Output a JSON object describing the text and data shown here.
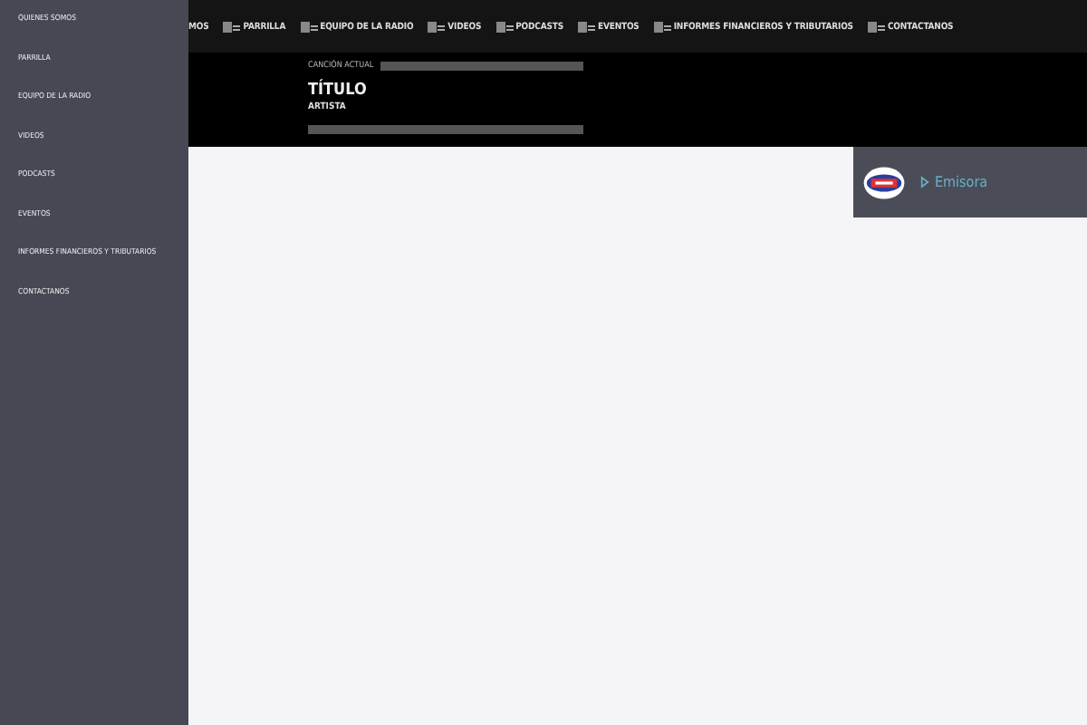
{
  "nav": [
    {
      "label": "MOS",
      "icon": false
    },
    {
      "label": "PARRILLA",
      "icon": true
    },
    {
      "label": "EQUIPO DE LA RADIO",
      "icon": true
    },
    {
      "label": "VIDEOS",
      "icon": true
    },
    {
      "label": "PODCASTS",
      "icon": true
    },
    {
      "label": "EVENTOS",
      "icon": true
    },
    {
      "label": "INFORMES FINANCIEROS Y TRIBUTARIOS",
      "icon": true
    },
    {
      "label": "CONTACTANOS",
      "icon": true
    }
  ],
  "player": {
    "caption": "CANCIÓN ACTUAL",
    "title": "TÍTULO",
    "artist": "ARTISTA"
  },
  "station": {
    "label": "Emisora"
  },
  "sidebar": {
    "items": [
      "QUIENES SOMOS",
      "PARRILLA",
      "EQUIPO DE LA RADIO",
      "VIDEOS",
      "PODCASTS",
      "EVENTOS",
      "INFORMES FINANCIEROS Y TRIBUTARIOS",
      "CONTACTANOS"
    ]
  }
}
